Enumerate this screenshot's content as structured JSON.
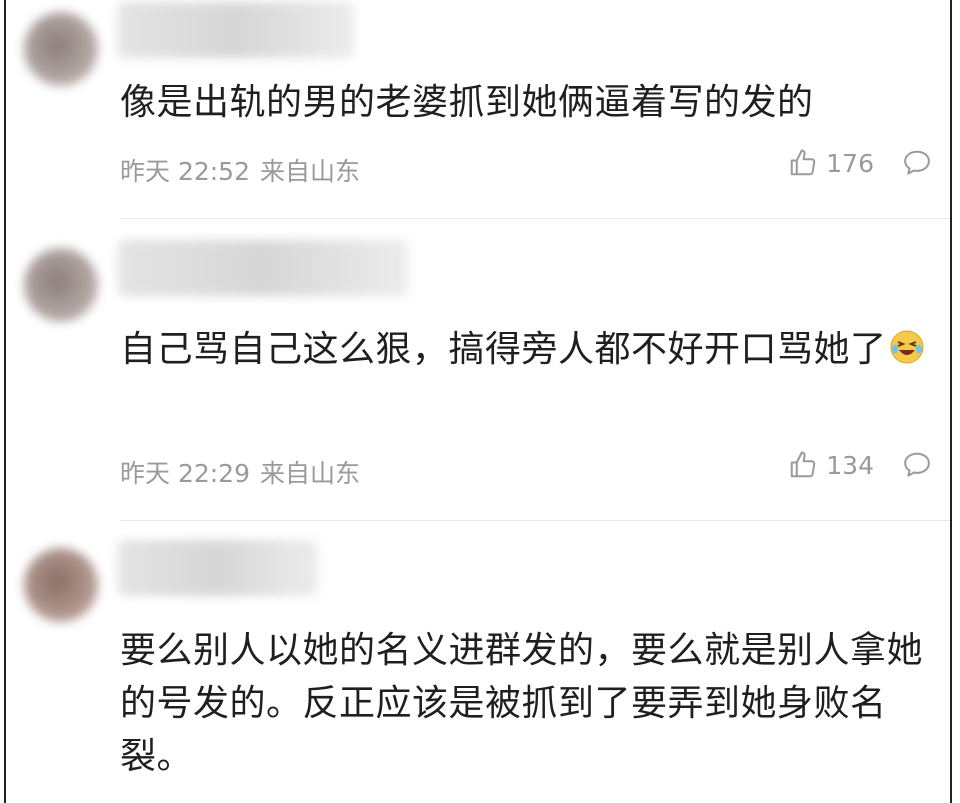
{
  "comments": [
    {
      "text": "像是出轨的男的老婆抓到她俩逼着写的发的",
      "time": "昨天 22:52",
      "location": "来自山东",
      "likes": "176"
    },
    {
      "text": "自己骂自己这么狠，搞得旁人都不好开口骂她了",
      "emoji": "laughing-crying",
      "time": "昨天 22:29",
      "location": "来自山东",
      "likes": "134"
    },
    {
      "text": "要么别人以她的名义进群发的，要么就是别人拿她的号发的。反正应该是被抓到了要弄到她身败名裂。"
    }
  ],
  "colors": {
    "meta": "#9a9a9a",
    "text": "#1f1f1f",
    "divider": "#e6e6e6"
  }
}
